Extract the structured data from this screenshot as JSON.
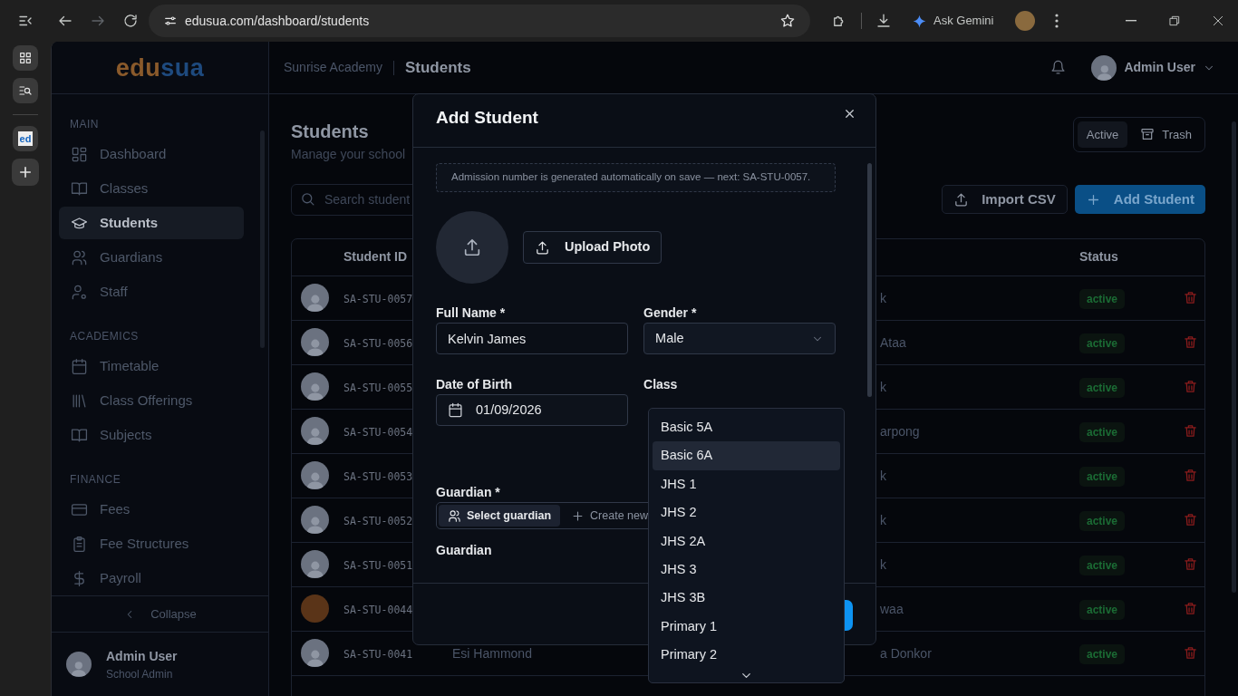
{
  "browser": {
    "url": "edusua.com/dashboard/students",
    "forward_disabled": true,
    "assistant_label": "Ask Gemini",
    "favicon_text": "ed"
  },
  "logo": {
    "first": "edu",
    "second": "sua"
  },
  "sidebar": {
    "sections": [
      {
        "heading": "MAIN",
        "items": [
          {
            "label": "Dashboard",
            "selected": false
          },
          {
            "label": "Classes",
            "selected": false
          },
          {
            "label": "Students",
            "selected": true
          },
          {
            "label": "Guardians",
            "selected": false
          },
          {
            "label": "Staff",
            "selected": false
          }
        ]
      },
      {
        "heading": "ACADEMICS",
        "items": [
          {
            "label": "Timetable",
            "selected": false
          },
          {
            "label": "Class Offerings",
            "selected": false
          },
          {
            "label": "Subjects",
            "selected": false
          }
        ]
      },
      {
        "heading": "FINANCE",
        "items": [
          {
            "label": "Fees",
            "selected": false
          },
          {
            "label": "Fee Structures",
            "selected": false
          },
          {
            "label": "Payroll",
            "selected": false
          }
        ]
      }
    ],
    "collapse_label": "Collapse",
    "user": {
      "name": "Admin User",
      "role": "School Admin"
    }
  },
  "topbar": {
    "breadcrumb": [
      "Sunrise Academy",
      "Students"
    ],
    "user_name": "Admin User"
  },
  "page": {
    "title": "Students",
    "subtitle": "Manage your school",
    "search_placeholder": "Search student",
    "view_toggle": [
      {
        "label": "Active",
        "selected": true
      },
      {
        "label": "Trash",
        "selected": false
      }
    ],
    "import_label": "Import CSV",
    "add_label": "Add Student"
  },
  "table": {
    "columns": [
      {
        "label": "Student ID"
      },
      {
        "label": "Status"
      }
    ],
    "rows": [
      {
        "has_photo": false,
        "student_id": "SA-STU-0057",
        "guardian": "k",
        "status": "active"
      },
      {
        "has_photo": false,
        "student_id": "SA-STU-0056",
        "guardian": "Ataa",
        "status": "active"
      },
      {
        "has_photo": false,
        "student_id": "SA-STU-0055",
        "guardian": "k",
        "status": "active"
      },
      {
        "has_photo": false,
        "student_id": "SA-STU-0054",
        "guardian": "arpong",
        "status": "active"
      },
      {
        "has_photo": false,
        "student_id": "SA-STU-0053",
        "guardian": "k",
        "status": "active"
      },
      {
        "has_photo": false,
        "student_id": "SA-STU-0052",
        "guardian": "k",
        "status": "active"
      },
      {
        "has_photo": false,
        "student_id": "SA-STU-0051",
        "guardian": "k",
        "status": "active"
      },
      {
        "has_photo": true,
        "student_id": "SA-STU-0044",
        "guardian": "waa",
        "status": "active"
      },
      {
        "has_photo": false,
        "student_id": "SA-STU-0041",
        "name": "Esi Hammond",
        "guardian": "a Donkor",
        "status": "active"
      }
    ]
  },
  "modal": {
    "title": "Add Student",
    "notice": "Admission number is generated automatically on save — next: SA-STU-0057.",
    "upload_label": "Upload Photo",
    "fields": [
      {
        "label": "Full Name *",
        "kind": "text",
        "value": "Kelvin James"
      },
      {
        "label": "Gender *",
        "kind": "select",
        "value": "Male"
      },
      {
        "label": "Date of Birth",
        "kind": "date",
        "value": "01/09/2026"
      },
      {
        "label": "Class",
        "kind": "open-select"
      }
    ],
    "guardian": {
      "label": "Guardian *",
      "modes": [
        {
          "label": "Select guardian",
          "selected": true
        },
        {
          "label": "Create new",
          "selected": false
        }
      ]
    },
    "next_label": "Guardian",
    "class_options": [
      {
        "label": "Basic 5A",
        "selected": false
      },
      {
        "label": "Basic 6A",
        "selected": true
      },
      {
        "label": "JHS 1",
        "selected": false
      },
      {
        "label": "JHS 2",
        "selected": false
      },
      {
        "label": "JHS 2A",
        "selected": false
      },
      {
        "label": "JHS 3",
        "selected": false
      },
      {
        "label": "JHS 3B",
        "selected": false
      },
      {
        "label": "Primary 1",
        "selected": false
      },
      {
        "label": "Primary 2",
        "selected": false
      }
    ]
  }
}
